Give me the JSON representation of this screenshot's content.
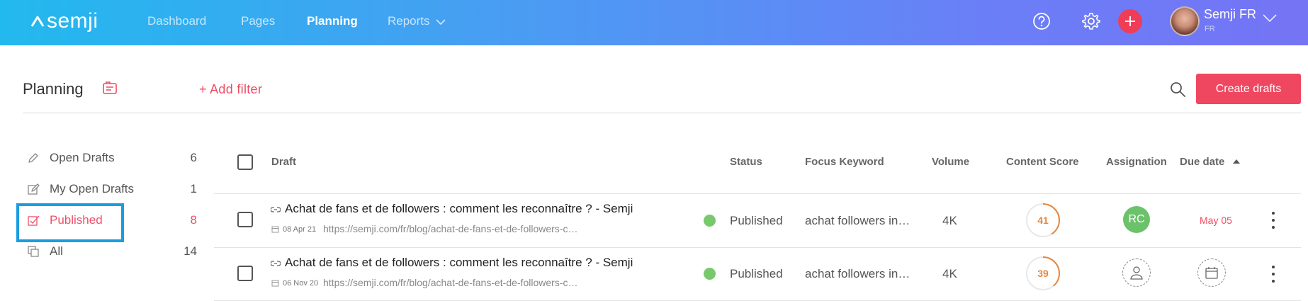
{
  "app": {
    "logo_text": "semji"
  },
  "nav": {
    "items": [
      {
        "label": "Dashboard",
        "active": false
      },
      {
        "label": "Pages",
        "active": false
      },
      {
        "label": "Planning",
        "active": true
      },
      {
        "label": "Reports",
        "active": false
      }
    ]
  },
  "user": {
    "name": "Semji FR",
    "workspace": "FR"
  },
  "colors": {
    "accent": "#ef4a61",
    "topbar_start": "#22b9ee",
    "topbar_end": "#7474f5",
    "published": "#78c96b",
    "score": "#e8873c",
    "selection": "#1a9de0"
  },
  "page": {
    "title": "Planning",
    "add_filter": "+ Add filter",
    "create_button": "Create drafts"
  },
  "sidebar": {
    "items": [
      {
        "label": "Open Drafts",
        "count": "6",
        "icon": "pencil-icon"
      },
      {
        "label": "My Open Drafts",
        "count": "1",
        "icon": "edit-icon"
      },
      {
        "label": "Published",
        "count": "8",
        "icon": "checkbox-icon",
        "active": true
      },
      {
        "label": "All",
        "count": "14",
        "icon": "copy-icon"
      }
    ]
  },
  "table": {
    "columns": [
      "Draft",
      "Status",
      "Focus Keyword",
      "Volume",
      "Content Score",
      "Assignation",
      "Due date"
    ],
    "sort": {
      "column": "Due date",
      "direction": "ascending"
    },
    "rows": [
      {
        "title": "Achat de fans et de followers : comment les reconnaître ? - Semji",
        "date": "08 Apr 21",
        "url": "https://semji.com/fr/blog/achat-de-fans-et-de-followers-c…",
        "status": "Published",
        "keyword": "achat followers in…",
        "volume": "4K",
        "score": "41",
        "score_fraction": 0.41,
        "assignee": "RC",
        "due": "May 05"
      },
      {
        "title": "Achat de fans et de followers : comment les reconnaître ? - Semji",
        "date": "06 Nov 20",
        "url": "https://semji.com/fr/blog/achat-de-fans-et-de-followers-c…",
        "status": "Published",
        "keyword": "achat followers in…",
        "volume": "4K",
        "score": "39",
        "score_fraction": 0.39,
        "assignee": "",
        "due": ""
      }
    ]
  }
}
